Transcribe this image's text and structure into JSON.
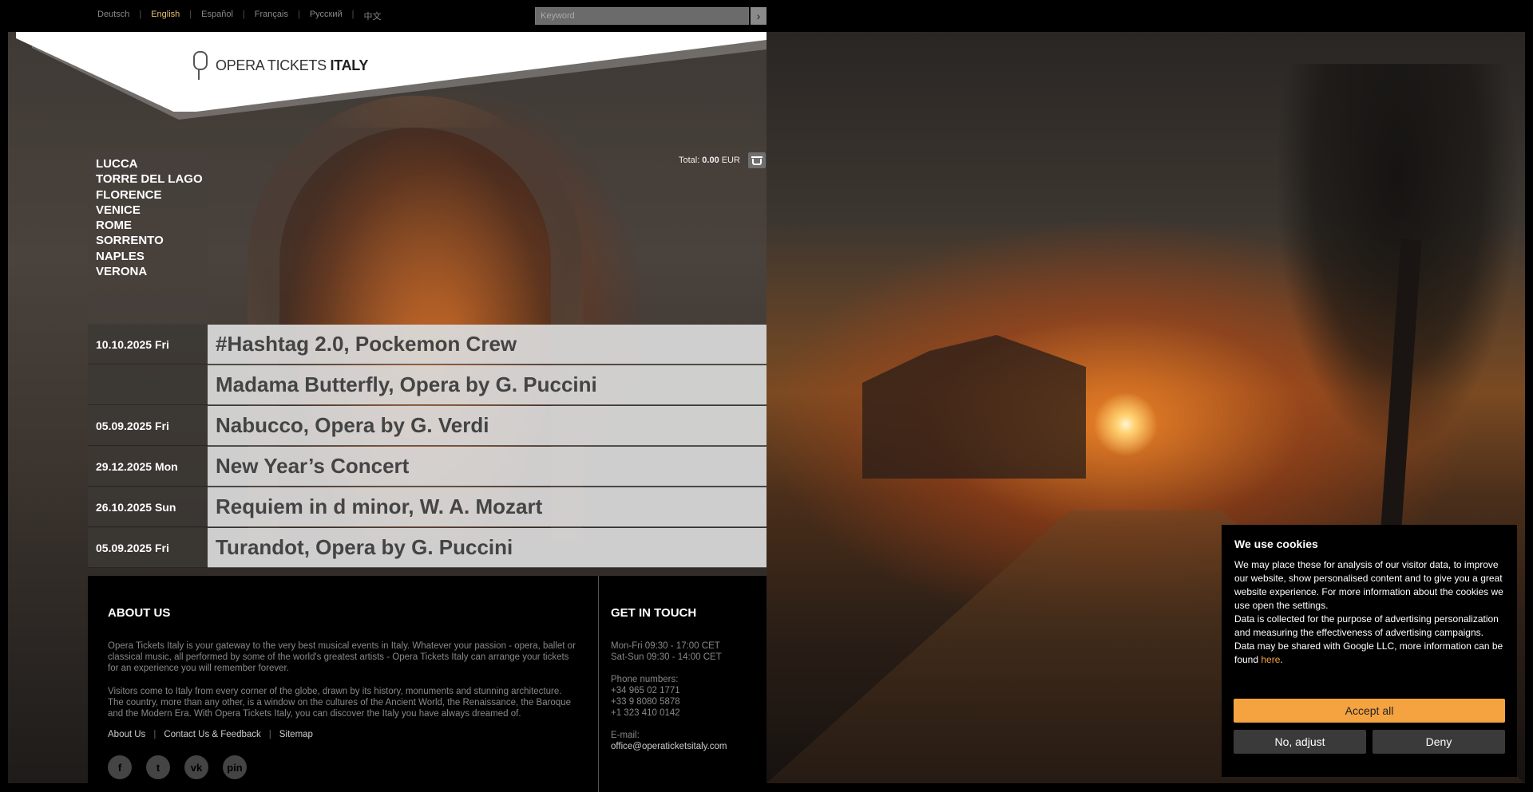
{
  "top": {
    "languages": [
      "Deutsch",
      "English",
      "Español",
      "Français",
      "Русский",
      "中文"
    ],
    "active_language": "English",
    "search_placeholder": "Keyword",
    "search_button": "›"
  },
  "logo": {
    "text_light": "OPERA TICKETS ",
    "text_bold": "ITALY"
  },
  "cities": [
    "LUCCA",
    "TORRE DEL LAGO",
    "FLORENCE",
    "VENICE",
    "ROME",
    "SORRENTO",
    "NAPLES",
    "VERONA"
  ],
  "cart": {
    "label": "Total:",
    "amount": "0.00",
    "currency": "EUR"
  },
  "events": [
    {
      "date": "10.10.2025 Fri",
      "title": "#Hashtag 2.0, Pockemon Crew"
    },
    {
      "date": "",
      "title": "Madama Butterfly, Opera by G. Puccini"
    },
    {
      "date": "05.09.2025 Fri",
      "title": "Nabucco, Opera by G. Verdi"
    },
    {
      "date": "29.12.2025 Mon",
      "title": "New Year’s Concert"
    },
    {
      "date": "26.10.2025 Sun",
      "title": "Requiem in d minor, W. A. Mozart"
    },
    {
      "date": "05.09.2025 Fri",
      "title": "Turandot, Opera by G. Puccini"
    }
  ],
  "footer": {
    "about_title": "ABOUT US",
    "about_p1": "Opera Tickets Italy is your gateway to the very best musical events in Italy. Whatever your passion - opera, ballet or classical music, all performed by some of the world's greatest artists - Opera Tickets Italy can arrange your tickets for an experience you will remember forever.",
    "about_p2": "Visitors come to Italy from every corner of the globe, drawn by its history, monuments and stunning architecture. The country, more than any other, is a window on the cultures of the Ancient World, the Renaissance, the Baroque and the Modern Era. With Opera Tickets Italy, you can discover the Italy you have always dreamed of.",
    "links": [
      "About Us",
      "Contact Us & Feedback",
      "Sitemap"
    ],
    "socials": [
      "f",
      "t",
      "vk",
      "pin"
    ],
    "contact_title": "GET IN TOUCH",
    "hours1": "Mon-Fri 09:30 - 17:00 CET",
    "hours2": "Sat-Sun 09:30 - 14:00 CET",
    "phone_label": "Phone numbers:",
    "phone1": "+34 965 02 1771",
    "phone2": "+33 9 8080 5878",
    "phone3": "+1 323 410 0142",
    "email_label": "E-mail:",
    "email": "office@operaticketsitaly.com"
  },
  "cookie": {
    "title": "We use cookies",
    "text1": "We may place these for analysis of our visitor data, to improve our website, show personalised content and to give you a great website experience. For more information about the cookies we use open the settings.",
    "text2": "Data is collected for the purpose of advertising personalization and measuring the effectiveness of advertising campaigns.",
    "text3": "Data may be shared with Google LLC, more information can be found ",
    "link": "here",
    "accept": "Accept all",
    "adjust": "No, adjust",
    "deny": "Deny",
    "accent": "#f4a340"
  }
}
